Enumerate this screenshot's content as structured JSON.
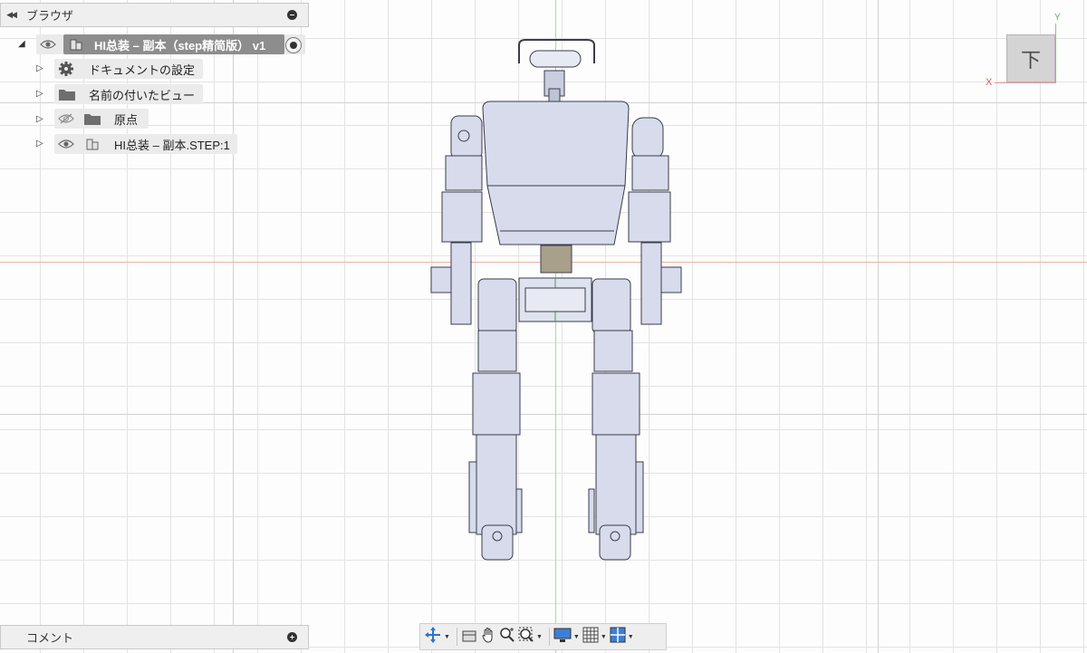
{
  "browser": {
    "title": "ブラウザ",
    "tree": {
      "root": {
        "label": "HI总装 – 副本（step精简版） v1"
      },
      "items": [
        {
          "label": "ドキュメントの設定"
        },
        {
          "label": "名前の付いたビュー"
        },
        {
          "label": "原点"
        },
        {
          "label": "HI总装 – 副本.STEP:1"
        }
      ]
    }
  },
  "viewcube": {
    "face": "下",
    "axis_x": "X",
    "axis_y": "Y"
  },
  "comments": {
    "label": "コメント"
  },
  "colors": {
    "x_axis": "#e35b5b",
    "y_axis": "#53b653",
    "root_highlight": "#8d8d8d",
    "model_fill": "#d7dbec",
    "model_stroke": "#3a3d4a"
  },
  "toolbar": {
    "icons": [
      "orbit-icon",
      "look-at-icon",
      "pan-icon",
      "zoom-icon",
      "fit-icon",
      "display-settings-icon",
      "grid-snap-icon",
      "viewports-icon"
    ]
  }
}
